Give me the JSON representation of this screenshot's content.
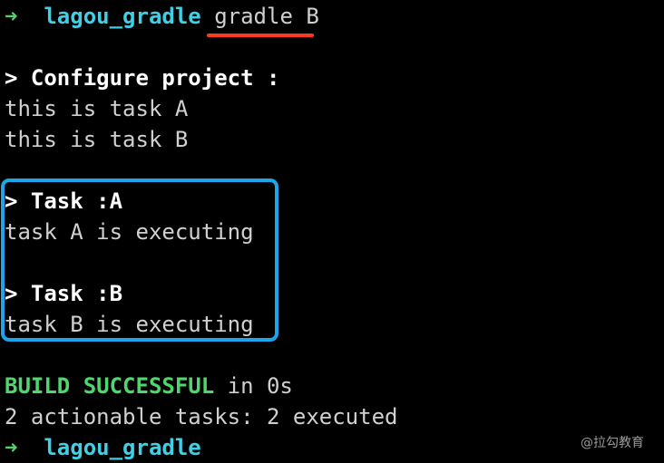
{
  "terminal": {
    "prompt_arrow": "➜",
    "prompt_dir": "lagou_gradle",
    "command": "gradle B",
    "configure_header": "> Configure project :",
    "config_lines": [
      "this is task A",
      "this is task B"
    ],
    "task_a_header": "> Task :A",
    "task_a_output": "task A is executing",
    "task_b_header": "> Task :B",
    "task_b_output": "task B is executing",
    "build_status": "BUILD SUCCESSFUL",
    "build_time": " in 0s",
    "tasks_summary": "2 actionable tasks: 2 executed",
    "final_prompt_arrow": "➜",
    "final_prompt_dir": "lagou_gradle"
  },
  "watermark": "@拉勾教育",
  "colors": {
    "background": "#000000",
    "prompt_arrow": "#4ed86c",
    "prompt_dir": "#3fd0e6",
    "success": "#4ed86c",
    "highlight_box": "#1aa6e8",
    "command_underline": "#ff3b1f"
  }
}
